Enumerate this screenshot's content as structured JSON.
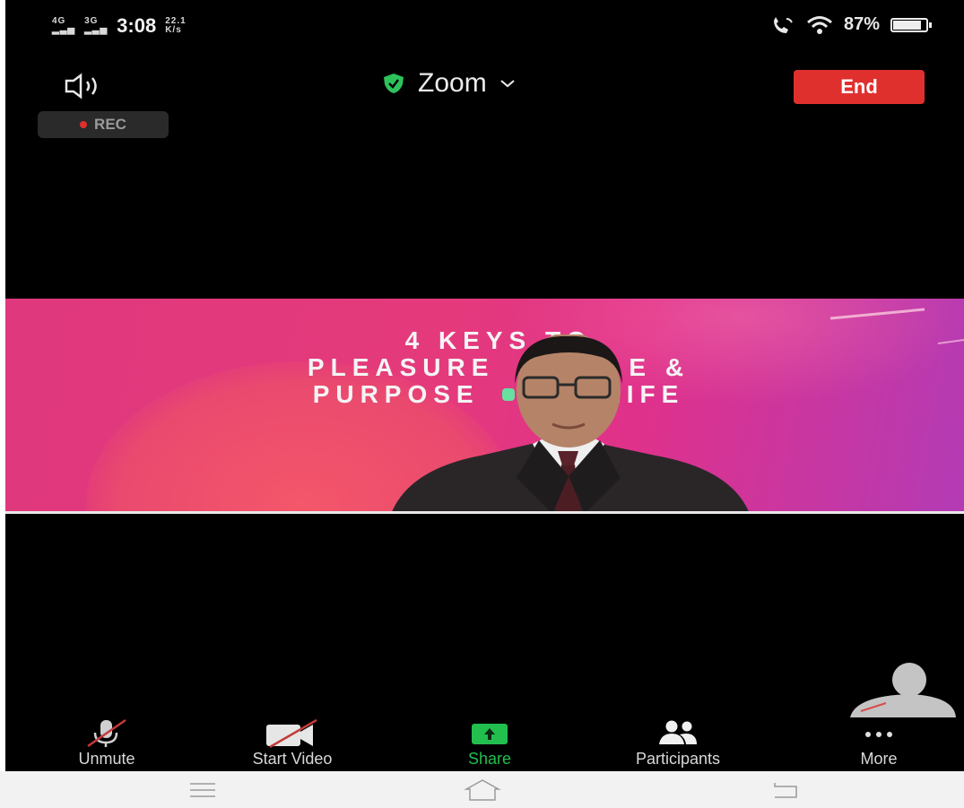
{
  "status_bar": {
    "network_1": "4G",
    "network_2": "3G",
    "time": "3:08",
    "data_speed": "22.1",
    "battery_percent": "87%",
    "battery_level": 0.87
  },
  "meeting": {
    "title": "Zoom",
    "end_label": "End",
    "rec_label": "REC"
  },
  "slide": {
    "line1": "4 KEYS TO",
    "line2": "PLEASURE",
    "line2b": "E &",
    "line3": "PURPOSE",
    "line3b": "LIFE"
  },
  "toolbar": {
    "unmute": "Unmute",
    "start_video": "Start Video",
    "share": "Share",
    "participants": "Participants",
    "more": "More"
  },
  "icons": {
    "speaker": "speaker-icon",
    "shield": "shield-check-icon",
    "chevron": "chevron-down-icon",
    "mic_off": "mic-off-icon",
    "video_off": "video-off-icon",
    "share": "share-arrow-icon",
    "participants": "participants-icon",
    "more": "more-dots-icon",
    "avatar": "avatar-icon",
    "menu": "menu-icon",
    "home": "home-icon",
    "back": "back-icon"
  },
  "colors": {
    "end_button": "#e0302e",
    "share_green": "#22bf4f",
    "shield_green": "#2ec25c",
    "background": "#000000",
    "slide_pink": "#e43a7c",
    "slide_purple": "#b33bb5"
  }
}
